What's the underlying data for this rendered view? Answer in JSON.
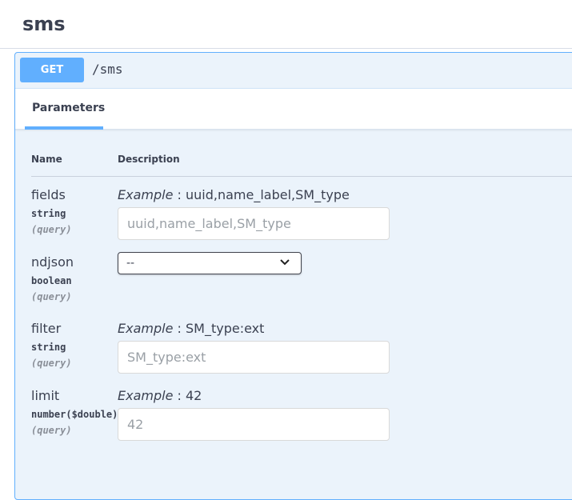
{
  "tag": {
    "title": "sms"
  },
  "operation": {
    "method": "GET",
    "path": "/sms"
  },
  "tabs": [
    {
      "label": "Parameters"
    }
  ],
  "columns": {
    "name": "Name",
    "description": "Description"
  },
  "example_label": "Example",
  "parameters": [
    {
      "name": "fields",
      "type": "string",
      "in": "(query)",
      "example": "uuid,name_label,SM_type",
      "placeholder": "uuid,name_label,SM_type"
    },
    {
      "name": "ndjson",
      "type": "boolean",
      "in": "(query)",
      "selected": "--"
    },
    {
      "name": "filter",
      "type": "string",
      "in": "(query)",
      "example": "SM_type:ext",
      "placeholder": "SM_type:ext"
    },
    {
      "name": "limit",
      "type": "number($double)",
      "in": "(query)",
      "example": "42",
      "placeholder": "42"
    }
  ],
  "colors": {
    "get": "#61affe",
    "opblock_bg": "#ebf3fb"
  },
  "icons": {
    "select_arrow": "chevron-down-icon"
  }
}
